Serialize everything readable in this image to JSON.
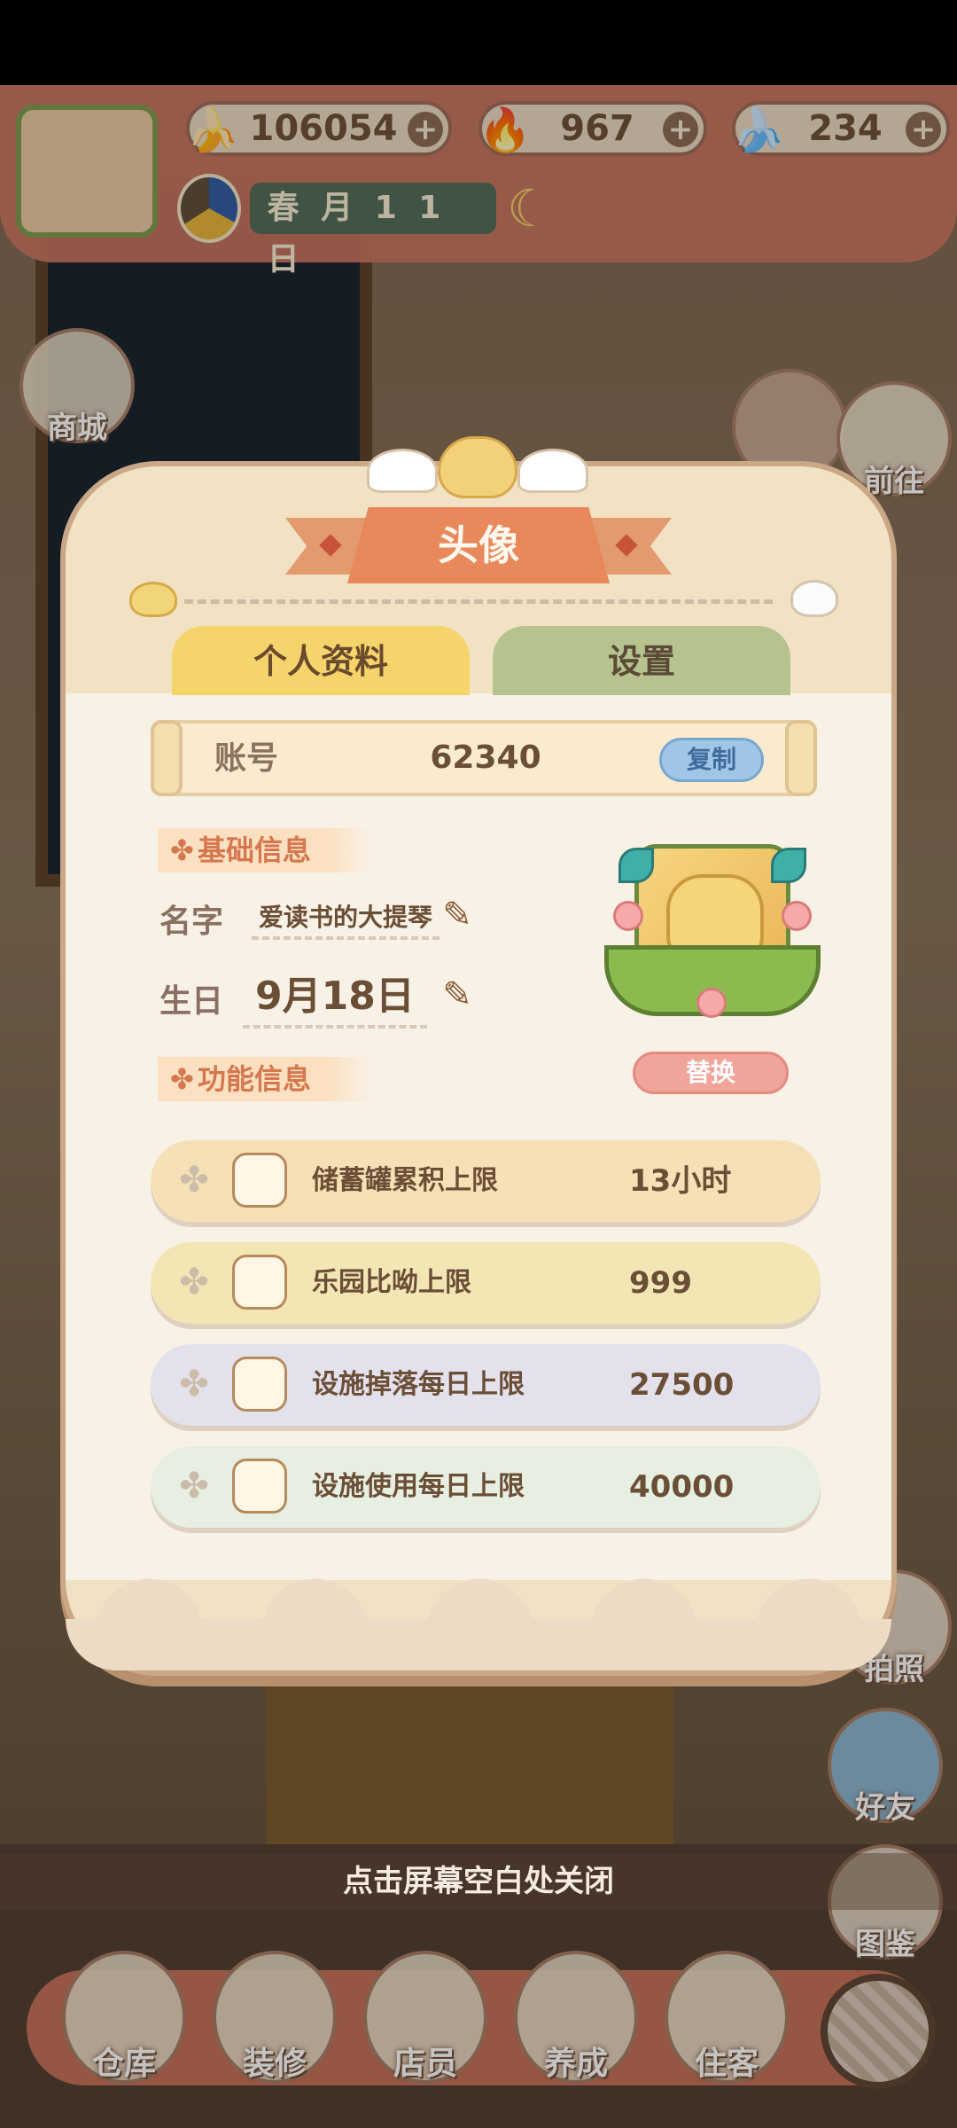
{
  "hud": {
    "currencies": [
      {
        "icon": "banana-icon",
        "value": "106054"
      },
      {
        "icon": "blue-flame-icon",
        "value": "967"
      },
      {
        "icon": "blue-banana-icon",
        "value": "234"
      }
    ],
    "date": "春 月 1 1 日"
  },
  "side_buttons_left": [
    {
      "label": "商城"
    }
  ],
  "side_buttons_right": [
    {
      "label": "前往"
    },
    {
      "label": "拍照"
    },
    {
      "label": "好友"
    },
    {
      "label": "图鉴"
    }
  ],
  "dialog": {
    "title": "头像",
    "tabs": [
      {
        "label": "个人资料",
        "active": true
      },
      {
        "label": "设置",
        "active": false
      }
    ],
    "account": {
      "label": "账号",
      "value": "62340",
      "copy_label": "复制"
    },
    "basic_section": "基础信息",
    "name_label": "名字",
    "name_value": "爱读书的大提琴",
    "birthday_label": "生日",
    "birthday_value": "9月18日",
    "replace_label": "替换",
    "function_section": "功能信息",
    "stats": [
      {
        "label": "储蓄罐累积上限",
        "value": "13小时",
        "bg": "#f6e1b6"
      },
      {
        "label": "乐园比呦上限",
        "value": "999",
        "bg": "#f3e6b5"
      },
      {
        "label": "设施掉落每日上限",
        "value": "27500",
        "bg": "#e3e1ec"
      },
      {
        "label": "设施使用每日上限",
        "value": "40000",
        "bg": "#e6efe2"
      }
    ]
  },
  "close_hint": "点击屏幕空白处关闭",
  "dock": [
    {
      "label": "仓库"
    },
    {
      "label": "装修"
    },
    {
      "label": "店员"
    },
    {
      "label": "养成"
    },
    {
      "label": "住客"
    }
  ],
  "colors": {
    "hud_bar": "#c8745f",
    "tab_profile": "#f5d46c",
    "tab_settings": "#b6c38f",
    "ribbon": "#e9885b",
    "copy_button": "#9fc6e6",
    "replace_button": "#f1a49a"
  }
}
